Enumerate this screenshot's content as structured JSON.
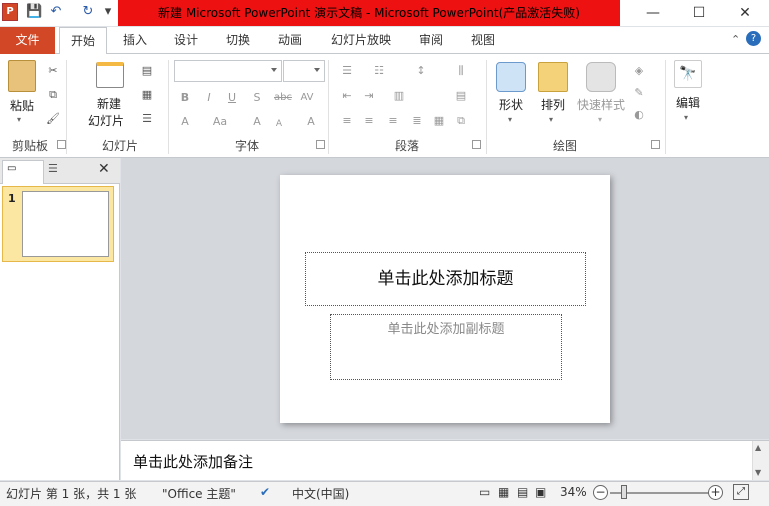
{
  "window": {
    "title": "新建 Microsoft PowerPoint 演示文稿 - Microsoft PowerPoint(产品激活失败)",
    "app_icon": "P",
    "minimize": "—",
    "maximize": "☐",
    "close": "✕"
  },
  "qat": {
    "save": "💾",
    "undo": "↶",
    "redo": "↻",
    "more": "▾"
  },
  "tabs": {
    "file": "文件",
    "items": [
      "开始",
      "插入",
      "设计",
      "切换",
      "动画",
      "幻灯片放映",
      "审阅",
      "视图"
    ]
  },
  "ribbon": {
    "clipboard": {
      "paste": "粘贴",
      "label": "剪贴板"
    },
    "slides": {
      "new_slide_1": "新建",
      "new_slide_2": "幻灯片",
      "label": "幻灯片"
    },
    "font": {
      "label": "字体",
      "bold": "B",
      "italic": "I",
      "underline": "U",
      "shadow": "S",
      "strike": "abc",
      "spacing": "AV",
      "case": "Aa",
      "grow": "A",
      "shrink": "A",
      "clear": "A",
      "color": "A"
    },
    "paragraph": {
      "label": "段落"
    },
    "drawing": {
      "shapes": "形状",
      "arrange": "排列",
      "quick_styles": "快速样式",
      "label": "绘图"
    },
    "editing": {
      "edit": "编辑"
    }
  },
  "thumbnails": {
    "slide_num": "1"
  },
  "slide": {
    "title_placeholder": "单击此处添加标题",
    "subtitle_placeholder": "单击此处添加副标题"
  },
  "notes": {
    "placeholder": "单击此处添加备注"
  },
  "status": {
    "slide_info": "幻灯片 第 1 张，共 1 张",
    "theme": "\"Office 主题\"",
    "language": "中文(中国)",
    "zoom": "34%",
    "zoom_fraction": 0.34
  }
}
